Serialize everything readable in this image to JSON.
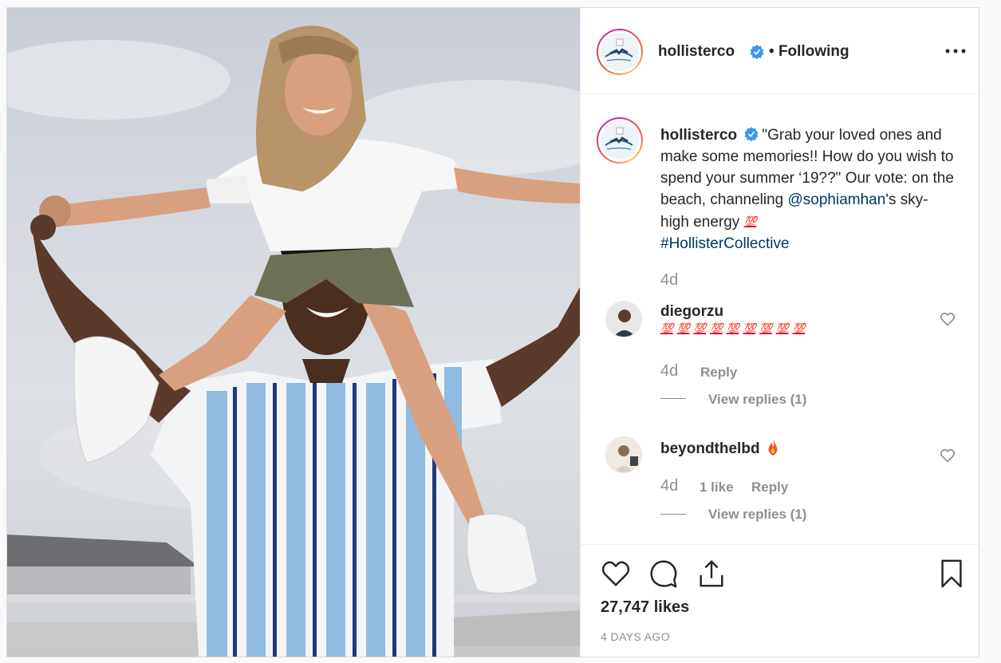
{
  "post": {
    "photo_alt": "",
    "header": {
      "username": "hollisterco",
      "separator": "•",
      "follow_status": "Following",
      "more_icon": "more-options-icon"
    },
    "caption": {
      "username": "hollisterco",
      "text_1": "\"Grab your loved ones and make some memories!! How do you wish to spend your summer ‘19??\" Our vote: on the beach, channeling ",
      "mention": "@sophiamhan",
      "text_2": "'s sky-high energy ",
      "emoji": "💯",
      "hashtag": "#HollisterCollective",
      "age": "4d"
    },
    "comments": [
      {
        "username": "diegorzu",
        "emoji_count": 9,
        "emoji": "💯",
        "age": "4d",
        "likes": "",
        "reply": "Reply",
        "view_replies": "View replies (1)"
      },
      {
        "username": "beyondthelbd",
        "text": "🔥",
        "age": "4d",
        "likes": "1 like",
        "reply": "Reply",
        "view_replies": "View replies (1)"
      }
    ],
    "likes": "27,747 likes",
    "timestamp": "4 DAYS AGO",
    "colors": {
      "link": "#003569",
      "meta": "#8e8e8e",
      "verified": "#3897f0",
      "hundred": "#d6132b"
    }
  }
}
